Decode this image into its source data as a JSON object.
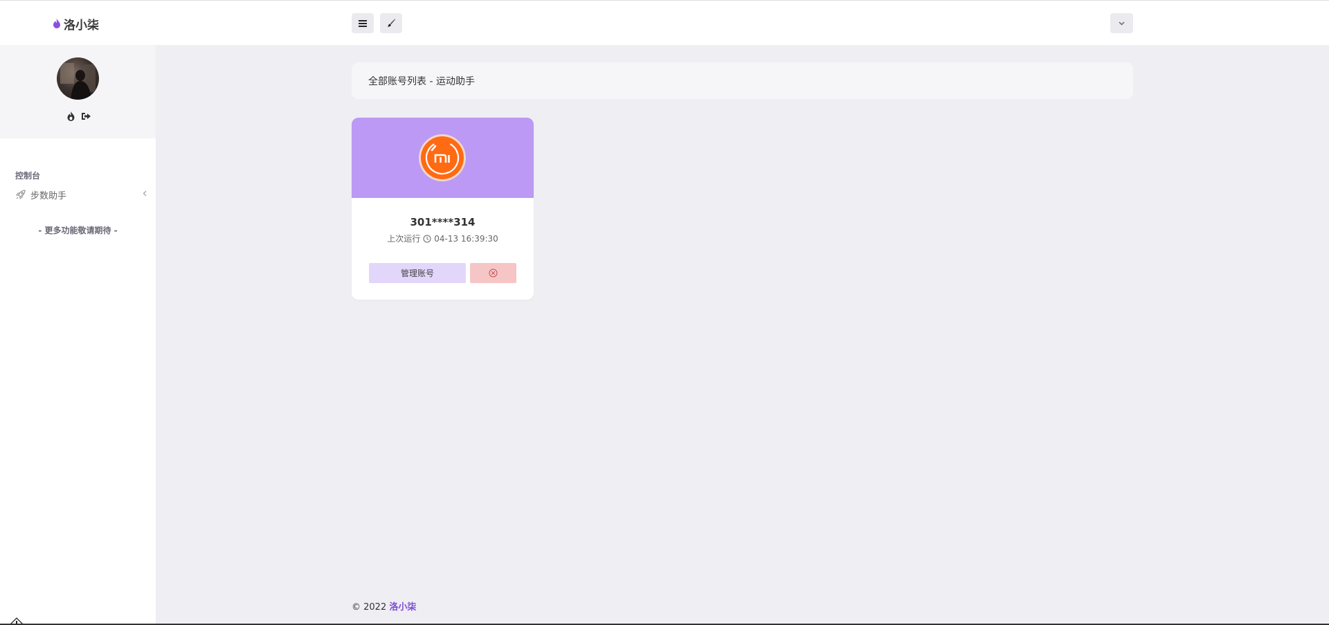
{
  "header": {
    "brand_name": "洛小柒",
    "menu_icon": "hamburger-icon",
    "brush_icon": "paintbrush-icon",
    "dropdown_icon": "chevron-down-icon"
  },
  "sidebar": {
    "section_title": "控制台",
    "items": [
      {
        "label": "步数助手",
        "icon": "rocket-icon"
      }
    ],
    "more_text": "- 更多功能敬请期待 -"
  },
  "main": {
    "breadcrumb": "全部账号列表 - 运动助手",
    "cards": [
      {
        "account_id": "301****314",
        "last_run_label": "上次运行",
        "last_run_time": "04-13 16:39:30",
        "manage_label": "管理账号"
      }
    ]
  },
  "footer": {
    "copyright": "© 2022",
    "link_text": "洛小柒"
  },
  "colors": {
    "accent": "#7b4fd6",
    "card_top": "#bb99f5",
    "manage_btn": "#e3d6fb",
    "delete_btn": "#f6c6c6",
    "mi_orange": "#ff6a13"
  }
}
